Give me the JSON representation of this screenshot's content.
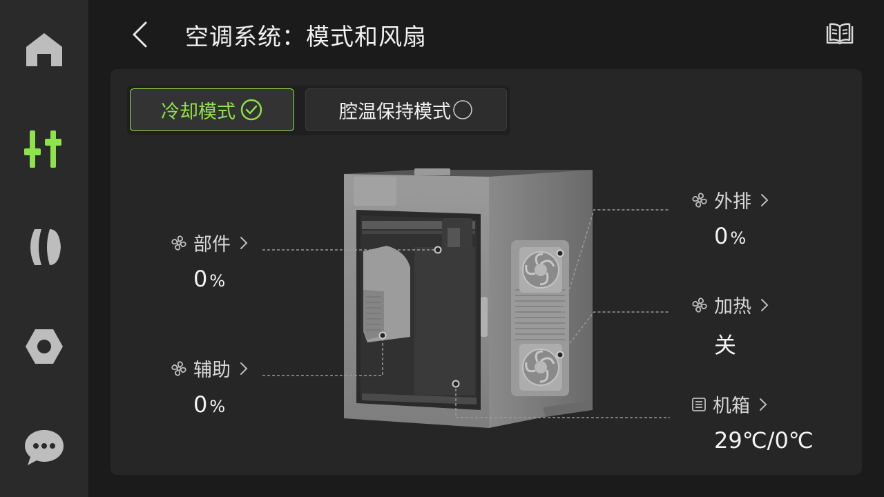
{
  "header": {
    "title": "空调系统：模式和风扇"
  },
  "modes": [
    {
      "label": "冷却模式",
      "selected": true
    },
    {
      "label": "腔温保持模式",
      "selected": false
    }
  ],
  "fans": {
    "part": {
      "label": "部件",
      "value": "0",
      "unit": "%"
    },
    "aux": {
      "label": "辅助",
      "value": "0",
      "unit": "%"
    },
    "exhaust": {
      "label": "外排",
      "value": "0",
      "unit": "%"
    },
    "heater": {
      "label": "加热",
      "value": "关"
    },
    "chamber": {
      "label": "机箱",
      "value": "29℃/0℃"
    }
  },
  "sidebar": {
    "items": [
      {
        "icon": "home-icon"
      },
      {
        "icon": "controls-icon",
        "active": true
      },
      {
        "icon": "filament-icon"
      },
      {
        "icon": "settings-nut-icon"
      },
      {
        "icon": "chat-icon"
      }
    ]
  },
  "colors": {
    "accent": "#8ee24a",
    "panel": "#262626",
    "sidebar": "#2a2a2a",
    "background": "#1b1b1b"
  }
}
